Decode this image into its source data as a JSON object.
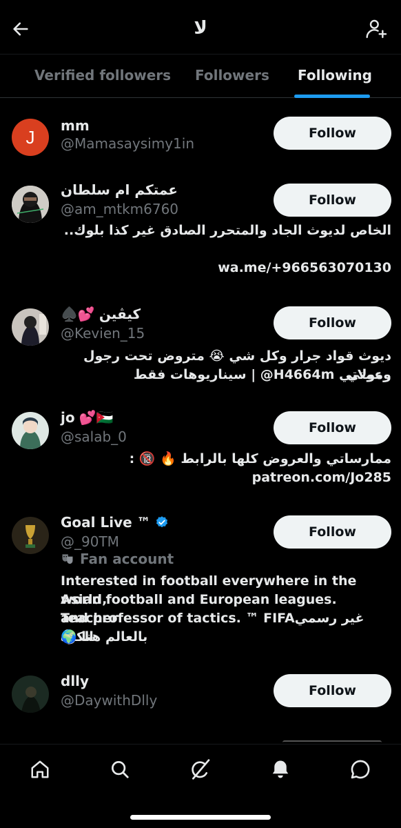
{
  "header": {
    "title": "لا",
    "back_icon": "arrow-left-icon",
    "add_user_icon": "person-add-icon"
  },
  "tabs": [
    {
      "label": "Verified followers",
      "active": false
    },
    {
      "label": "Followers",
      "active": false
    },
    {
      "label": "Following",
      "active": true
    }
  ],
  "users": [
    {
      "name": "mm",
      "handle": "@Mamasaysimy1in",
      "avatar_letter": "J",
      "follow_label": "Follow",
      "bio": ""
    },
    {
      "name": "عمتكم ام سلطان",
      "handle": "@am_mtkm6760",
      "follow_label": "Follow",
      "bio_line1": "الخاص لديوث الجاد والمتحرر الصادق غير كذا بلوك..",
      "bio_line2": "wa.me/+966563070130"
    },
    {
      "name": "كيڤين",
      "name_emoji": "♠️💕",
      "handle": "@Kevien_15",
      "follow_label": "Follow",
      "bio_line1": "ديوث قواد جرار وكل شي 😭 متروض تحت رجول وعمتي",
      "bio_line2": "ومولاتي H4664m@ | سيناريوهات فقط"
    },
    {
      "name": "jo",
      "name_emoji": "💕🇯🇴",
      "handle": "@salab_0",
      "follow_label": "Follow",
      "bio_line1": "ممارساتي والعروض كلها بالرابط 🔥 🔞 :",
      "bio_line2": "patreon.com/Jo285"
    },
    {
      "name": "Goal Live ™",
      "verified": true,
      "handle": "@_90TM",
      "fan_label": "Fan account",
      "fan_icon": "theater-masks-icon",
      "follow_label": "Follow",
      "bio_line1": "Interested in football everywhere in the world,",
      "bio_line2": "Asian football and European leagues. Teacher",
      "bio_line3": "and professor of tactics. ™ FIFAغير رسمي الكرة",
      "bio_line4": "🌍 بالعالم هنا"
    },
    {
      "name": "dlly",
      "handle": "@DaywithDlly",
      "follow_label": "Follow",
      "bio": ""
    }
  ],
  "nav": [
    {
      "icon": "home-icon",
      "active": false
    },
    {
      "icon": "search-icon",
      "active": false
    },
    {
      "icon": "grok-icon",
      "active": false
    },
    {
      "icon": "notifications-bell-icon",
      "active": true
    },
    {
      "icon": "messages-icon",
      "active": false
    }
  ],
  "colors": {
    "background": "#000000",
    "primary_text": "#e7e9ea",
    "secondary_text": "#71767b",
    "accent": "#1d9bf0",
    "follow_button_bg": "#eff3f4"
  }
}
